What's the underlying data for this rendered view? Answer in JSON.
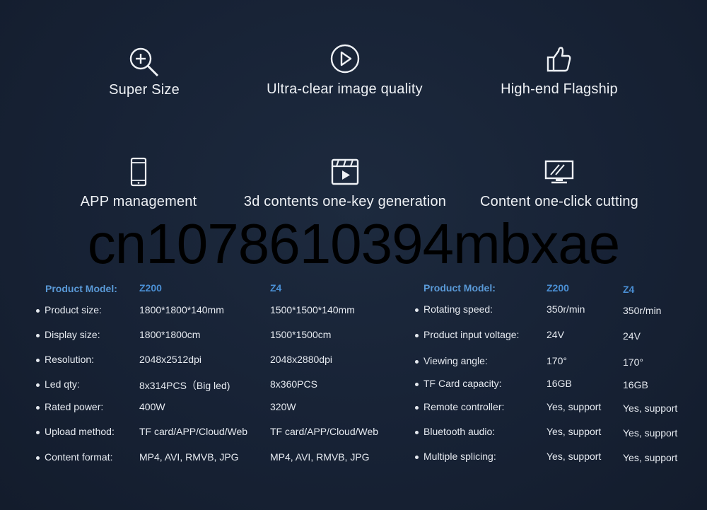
{
  "features": [
    {
      "label": "Super Size",
      "icon": "zoom-in-icon"
    },
    {
      "label": "Ultra-clear image quality",
      "icon": "play-circle-icon"
    },
    {
      "label": "High-end Flagship",
      "icon": "thumbs-up-icon"
    },
    {
      "label": "APP management",
      "icon": "smartphone-icon"
    },
    {
      "label": "3d contents one-key generation",
      "icon": "video-clip-icon"
    },
    {
      "label": "Content one-click cutting",
      "icon": "monitor-icon"
    }
  ],
  "watermark": "cn1078610394mbxae",
  "left_table": {
    "header_label": "Product Model:",
    "models": [
      "Z200",
      "Z4"
    ],
    "rows": [
      {
        "key": "Product size:",
        "z200": "1800*1800*140mm",
        "z4": "1500*1500*140mm"
      },
      {
        "key": "Display size:",
        "z200": "1800*1800cm",
        "z4": "1500*1500cm"
      },
      {
        "key": "Resolution:",
        "z200": "2048x2512dpi",
        "z4": "2048x2880dpi"
      },
      {
        "key": "Led qty:",
        "z200": "8x314PCS（Big led)",
        "z4": "8x360PCS"
      },
      {
        "key": "Rated power:",
        "z200": "400W",
        "z4": "320W"
      },
      {
        "key": "Upload method:",
        "z200": "TF card/APP/Cloud/Web",
        "z4": "TF card/APP/Cloud/Web"
      },
      {
        "key": "Content format:",
        "z200": "MP4, AVI, RMVB, JPG",
        "z4": "MP4, AVI, RMVB, JPG"
      }
    ]
  },
  "right_table": {
    "header_label": "Product Model:",
    "models": [
      "Z200",
      "Z4"
    ],
    "rows": [
      {
        "key": "Rotating speed:",
        "z200": "350r/min",
        "z4": "350r/min"
      },
      {
        "key": "Product input voltage:",
        "z200": "24V",
        "z4": "24V"
      },
      {
        "key": "Viewing angle:",
        "z200": "170°",
        "z4": "170°"
      },
      {
        "key": "TF Card capacity:",
        "z200": "16GB",
        "z4": "16GB"
      },
      {
        "key": "Remote controller:",
        "z200": "Yes, support",
        "z4": "Yes, support"
      },
      {
        "key": "Bluetooth audio:",
        "z200": "Yes, support",
        "z4": "Yes, support"
      },
      {
        "key": "Multiple splicing:",
        "z200": "Yes, support",
        "z4": "Yes, support"
      }
    ]
  }
}
